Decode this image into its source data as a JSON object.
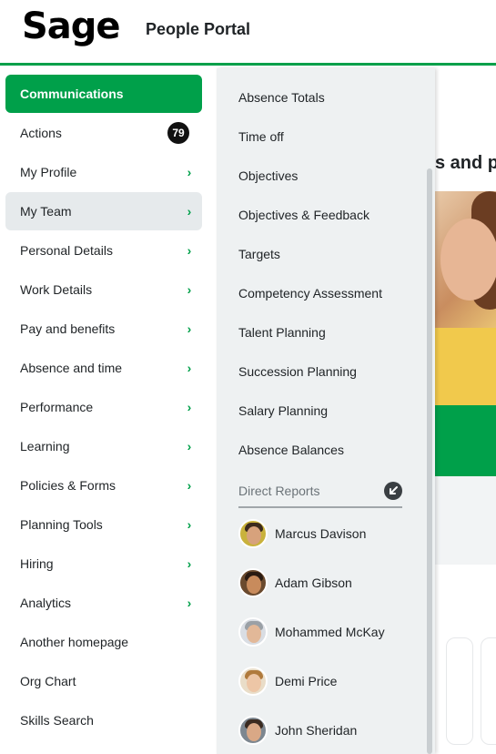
{
  "header": {
    "logo_text": "Sage",
    "portal_title": "People Portal"
  },
  "main": {
    "heading_fragment": "s and p"
  },
  "sidebar": {
    "items": [
      {
        "label": "Communications",
        "state": "active",
        "chevron": false
      },
      {
        "label": "Actions",
        "badge": "79",
        "chevron": false
      },
      {
        "label": "My Profile",
        "chevron": true
      },
      {
        "label": "My Team",
        "state": "selected",
        "chevron": true
      },
      {
        "label": "Personal Details",
        "chevron": true
      },
      {
        "label": "Work Details",
        "chevron": true
      },
      {
        "label": "Pay and benefits",
        "chevron": true
      },
      {
        "label": "Absence and time",
        "chevron": true
      },
      {
        "label": "Performance",
        "chevron": true
      },
      {
        "label": "Learning",
        "chevron": true
      },
      {
        "label": "Policies & Forms",
        "chevron": true
      },
      {
        "label": "Planning Tools",
        "chevron": true
      },
      {
        "label": "Hiring",
        "chevron": true
      },
      {
        "label": "Analytics",
        "chevron": true
      },
      {
        "label": "Another homepage",
        "chevron": false
      },
      {
        "label": "Org Chart",
        "chevron": false
      },
      {
        "label": "Skills Search",
        "chevron": false
      }
    ]
  },
  "submenu": {
    "items": [
      "Absence Totals",
      "Time off",
      "Objectives",
      "Objectives & Feedback",
      "Targets",
      "Competency Assessment",
      "Talent Planning",
      "Succession Planning",
      "Salary Planning",
      "Absence Balances"
    ],
    "section_title": "Direct Reports",
    "reports": [
      {
        "name": "Marcus Davison"
      },
      {
        "name": "Adam Gibson"
      },
      {
        "name": "Mohammed McKay"
      },
      {
        "name": "Demi Price"
      },
      {
        "name": "John Sheridan"
      }
    ]
  },
  "icons": {
    "chevron": "chevron-right-icon",
    "collapse": "arrow-down-left-icon"
  },
  "colors": {
    "accent": "#00a04a",
    "badge": "#111111",
    "selected_bg": "#e6eaec",
    "submenu_bg": "#eef1f2"
  }
}
